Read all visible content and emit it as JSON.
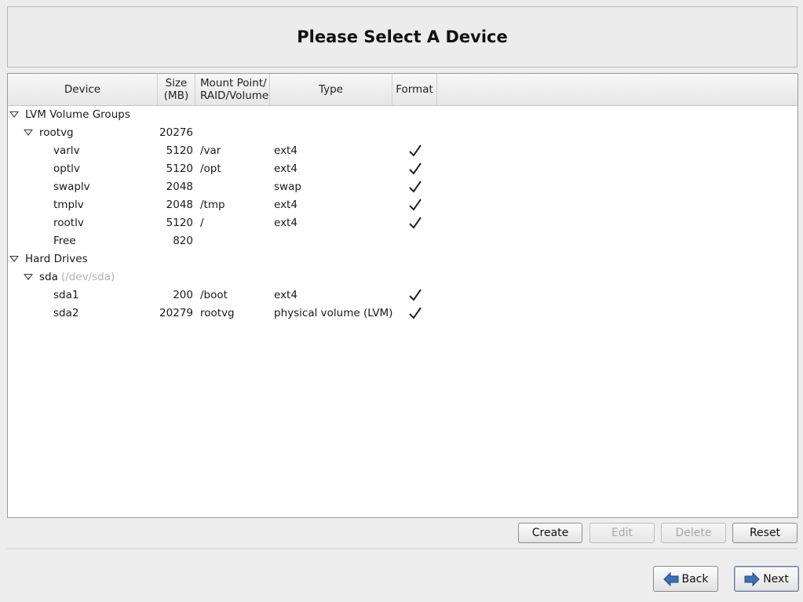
{
  "header": {
    "title": "Please Select A Device"
  },
  "columns": {
    "device": "Device",
    "size_line1": "Size",
    "size_line2": "(MB)",
    "mount_line1": "Mount Point/",
    "mount_line2": "RAID/Volume",
    "type": "Type",
    "format": "Format"
  },
  "groups": {
    "lvm": {
      "label": "LVM Volume Groups",
      "vg": {
        "name": "rootvg",
        "size": "20276"
      },
      "volumes": [
        {
          "device": "varlv",
          "size": "5120",
          "mount": "/var",
          "type": "ext4",
          "format": true
        },
        {
          "device": "optlv",
          "size": "5120",
          "mount": "/opt",
          "type": "ext4",
          "format": true
        },
        {
          "device": "swaplv",
          "size": "2048",
          "mount": "",
          "type": "swap",
          "format": true
        },
        {
          "device": "tmplv",
          "size": "2048",
          "mount": "/tmp",
          "type": "ext4",
          "format": true
        },
        {
          "device": "rootlv",
          "size": "5120",
          "mount": "/",
          "type": "ext4",
          "format": true
        },
        {
          "device": "Free",
          "size": "820",
          "mount": "",
          "type": "",
          "format": false
        }
      ]
    },
    "hd": {
      "label": "Hard Drives",
      "disk": {
        "name": "sda",
        "path": "(/dev/sda)"
      },
      "partitions": [
        {
          "device": "sda1",
          "size": "200",
          "mount": "/boot",
          "type": "ext4",
          "format": true
        },
        {
          "device": "sda2",
          "size": "20279",
          "mount": "rootvg",
          "type": "physical volume (LVM)",
          "format": true
        }
      ]
    }
  },
  "actions": {
    "create": "Create",
    "edit": "Edit",
    "delete": "Delete",
    "reset": "Reset"
  },
  "nav": {
    "back": "Back",
    "next": "Next"
  },
  "icons": {
    "checkmark": "checkmark-icon",
    "back": "left-arrow-icon",
    "next": "right-arrow-icon",
    "expander": "triangle-down-icon"
  },
  "colors": {
    "arrow_blue": "#3d6fb4",
    "window_bg": "#ededed"
  }
}
